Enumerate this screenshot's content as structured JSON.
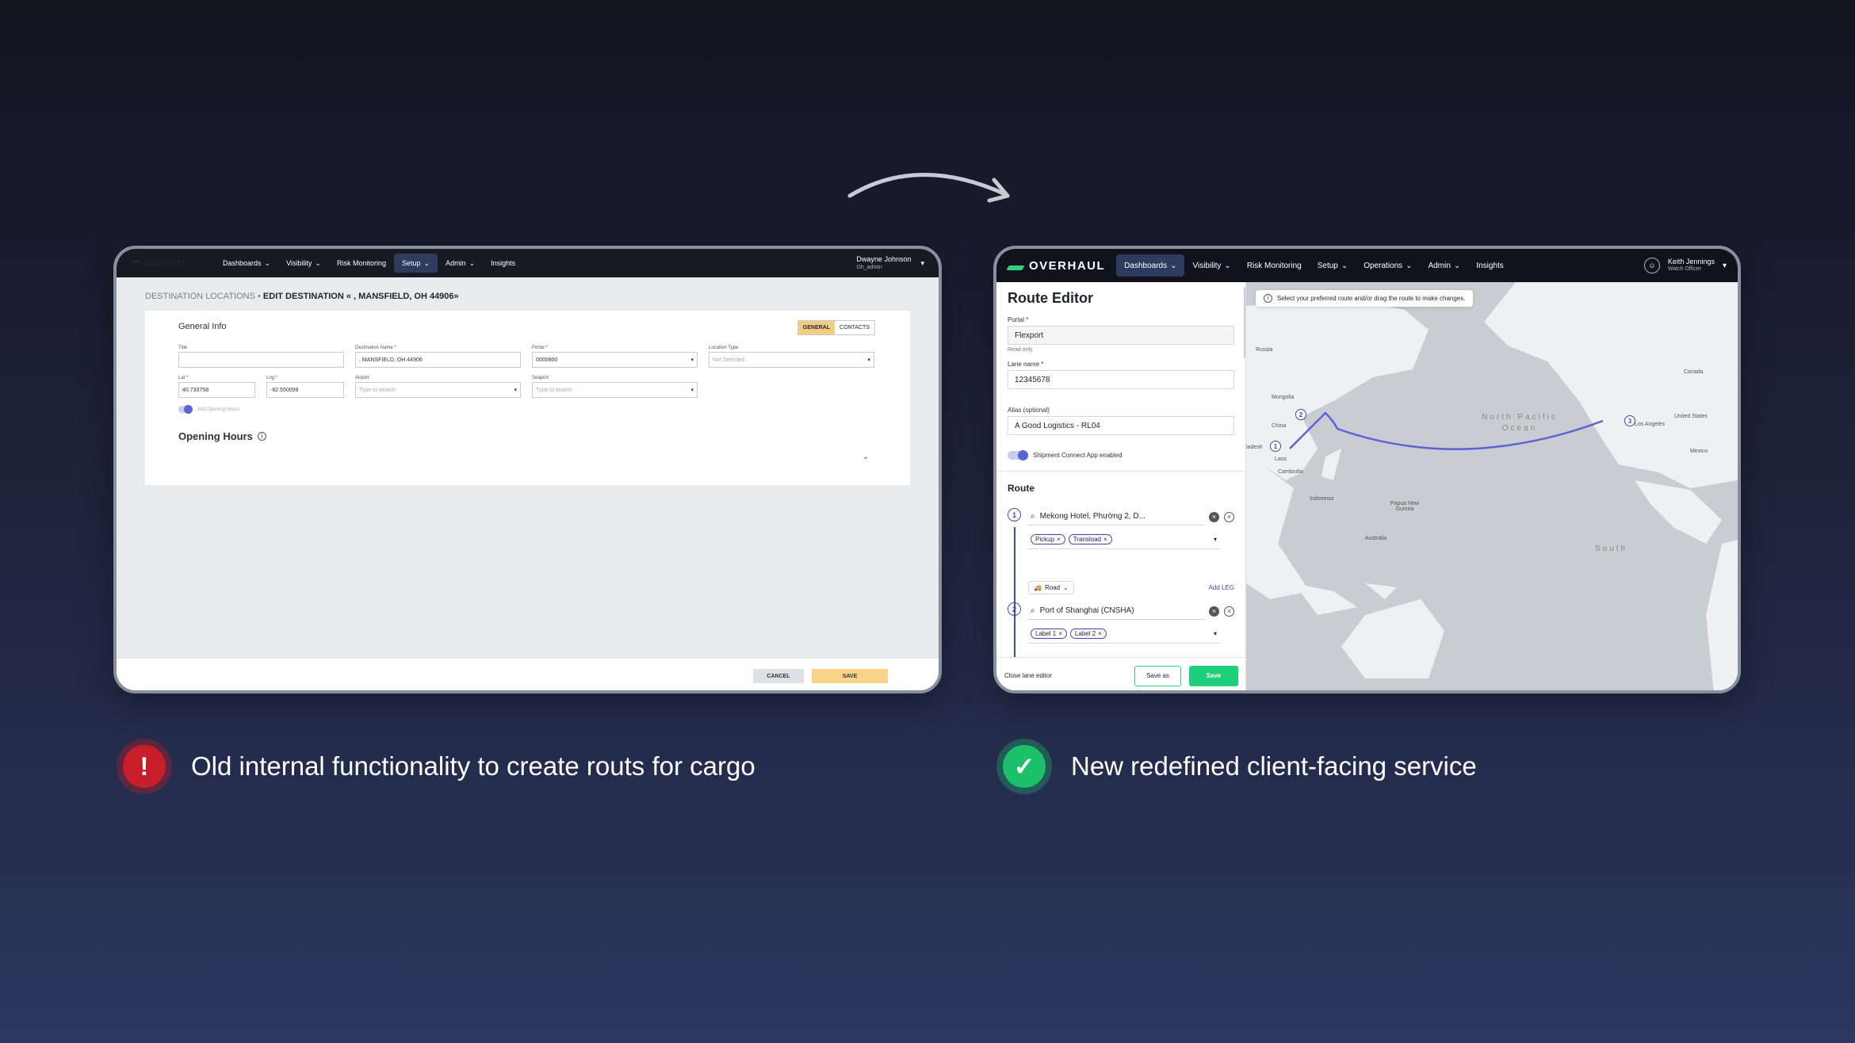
{
  "old_app": {
    "logo": "DIZIGIAL",
    "nav": [
      "Dashboards",
      "Visibility",
      "Risk Monitoring",
      "Setup",
      "Admin",
      "Insights"
    ],
    "active_nav": "Setup",
    "user": {
      "name": "Dwayne Johnson",
      "role": "Oh_admin"
    },
    "breadcrumb_parent": "DESTINATION LOCATIONS",
    "breadcrumb_current": "EDIT DESTINATION « , MANSFIELD, OH 44906»",
    "section_title": "General Info",
    "tabs": {
      "general": "GENERAL",
      "contacts": "CONTACTS"
    },
    "fields": {
      "title_label": "Title",
      "title_value": "",
      "dest_name_label": "Destination Name *",
      "dest_name_value": ", MANSFIELD, OH 44906",
      "portal_label": "Portal *",
      "portal_value": "0000800",
      "location_type_label": "Location Type",
      "location_type_value": "Not Selected",
      "lat_label": "Lat *",
      "lat_value": "40.733758",
      "lng_label": "Lng *",
      "lng_value": "-82.550099",
      "airport_label": "Airport",
      "airport_placeholder": "Type to search",
      "seaport_label": "Seaport",
      "seaport_placeholder": "Type to search"
    },
    "toggle_label": "Add Opening Hours",
    "opening_hours": "Opening Hours",
    "buttons": {
      "cancel": "CANCEL",
      "save": "SAVE"
    }
  },
  "new_app": {
    "logo": "OVERHAUL",
    "nav": [
      "Dashboards",
      "Visibility",
      "Risk Monitoring",
      "Setup",
      "Operations",
      "Admin",
      "Insights"
    ],
    "active_nav": "Dashboards",
    "user": {
      "name": "Keith Jennings",
      "role": "Watch Officer"
    },
    "panel_title": "Route Editor",
    "portal_label": "Portal *",
    "portal_value": "Flexport",
    "portal_note": "Read only",
    "lane_label": "Lane name *",
    "lane_value": "12345678",
    "alias_label": "Alias (optional)",
    "alias_value": "A Good Logistics - RL04",
    "toggle_label": "Shipment Connect App enabled",
    "route_title": "Route",
    "stops": [
      {
        "num": "1",
        "name": "Mekong Hotel, Phường 2, D...",
        "chips": [
          "Pickup",
          "Transload"
        ]
      },
      {
        "num": "2",
        "name": "Port of Shanghai (CNSHA)",
        "chips": [
          "Label 1",
          "Label 2"
        ]
      }
    ],
    "leg_mode": "Road",
    "add_leg": "Add LEG",
    "buttons": {
      "close": "Close lane editor",
      "save_as": "Save as",
      "save": "Save"
    },
    "map_tip": "Select your preferred route and/or drag the route to make changes.",
    "map_labels": {
      "russia": "Russia",
      "canada": "Canada",
      "mongolia": "Mongolia",
      "china": "China",
      "us": "United States",
      "mexico": "Mexico",
      "laos": "Laos",
      "cambodia": "Cambodia",
      "indonesia": "Indonesia",
      "png": "Papua New Guinea",
      "australia": "Australia",
      "bangladesh": "ladesh",
      "pacific": "North Pacific Ocean",
      "south": "South",
      "la": "Los Angeles"
    },
    "markers": [
      "1",
      "2",
      "3"
    ]
  },
  "captions": {
    "old": "Old internal functionality to create routs for cargo",
    "new": "New redefined client-facing service"
  },
  "colors": {
    "accent": "#3b4ab5",
    "save_green": "#1fd07a",
    "old_save": "#f8d48a",
    "alert_red": "#c81e2a",
    "ok_green": "#1bc06b"
  }
}
